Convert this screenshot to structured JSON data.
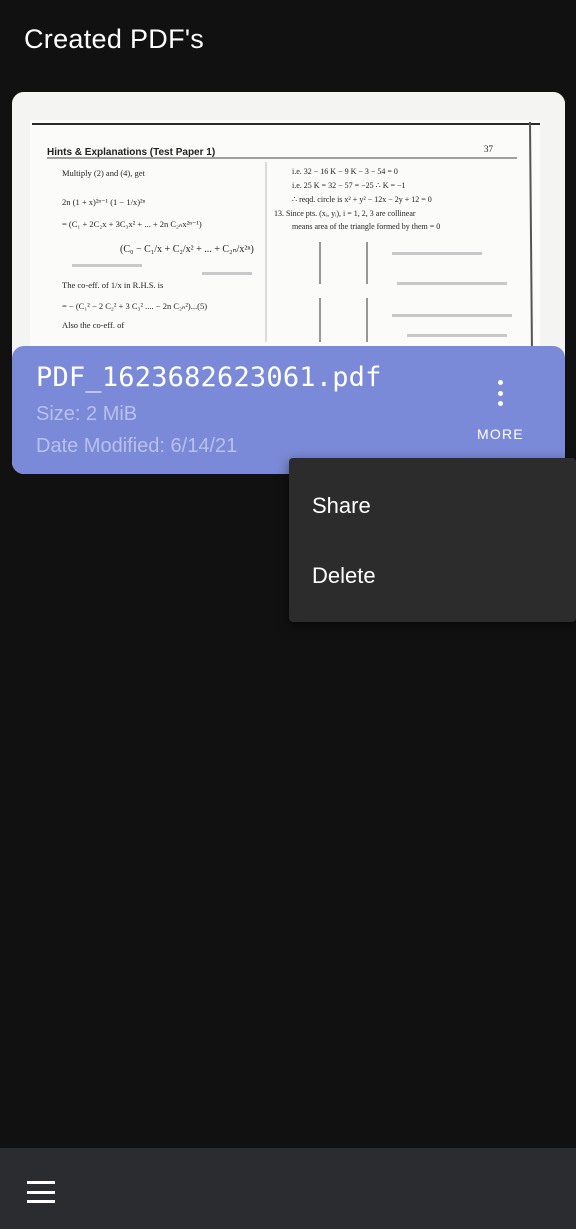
{
  "header": {
    "title": "Created PDF's"
  },
  "card": {
    "filename": "PDF_1623682623061.pdf",
    "size": "Size: 2 MiB",
    "date_modified": "Date Modified: 6/14/21",
    "more_label": "MORE",
    "more_icon": "more-vert-icon"
  },
  "thumbnail": {
    "page_number": "37",
    "heading": "Hints & Explanations (Test Paper 1)",
    "left_lines": [
      "Multiply (2) and (4), get",
      "2n (1 + x)²ⁿ⁻¹ (1 − 1/x)²ⁿ",
      "= (C₁ + 2C₂x + 3C₃x² + ... + 2n C₂ₙx²ⁿ⁻¹)",
      "(C₀ − C₁/x + C₂/x² + ... + C₂ₙ/x²ⁿ)",
      "The co-eff. of 1/x in R.H.S. is",
      "= − (C₁² − 2 C₂² + 3 C₃² .... − 2n C₂ₙ²)...(5)",
      "Also the co-eff. of"
    ],
    "right_lines": [
      "i.e. 32 − 16 K − 9 K − 3 − 54 = 0",
      "i.e. 25 K = 32 − 57 = −25 ∴ K = −1",
      "∴ reqd. circle is x² + y² − 12x − 2y + 12 = 0",
      "13. Since pts. (xᵢ, yᵢ), i = 1, 2, 3 are collinear",
      "means area of the triangle formed by them = 0"
    ]
  },
  "menu": {
    "items": [
      {
        "label": "Share"
      },
      {
        "label": "Delete"
      }
    ]
  },
  "bottom_bar": {
    "icon": "hamburger-menu-icon"
  }
}
